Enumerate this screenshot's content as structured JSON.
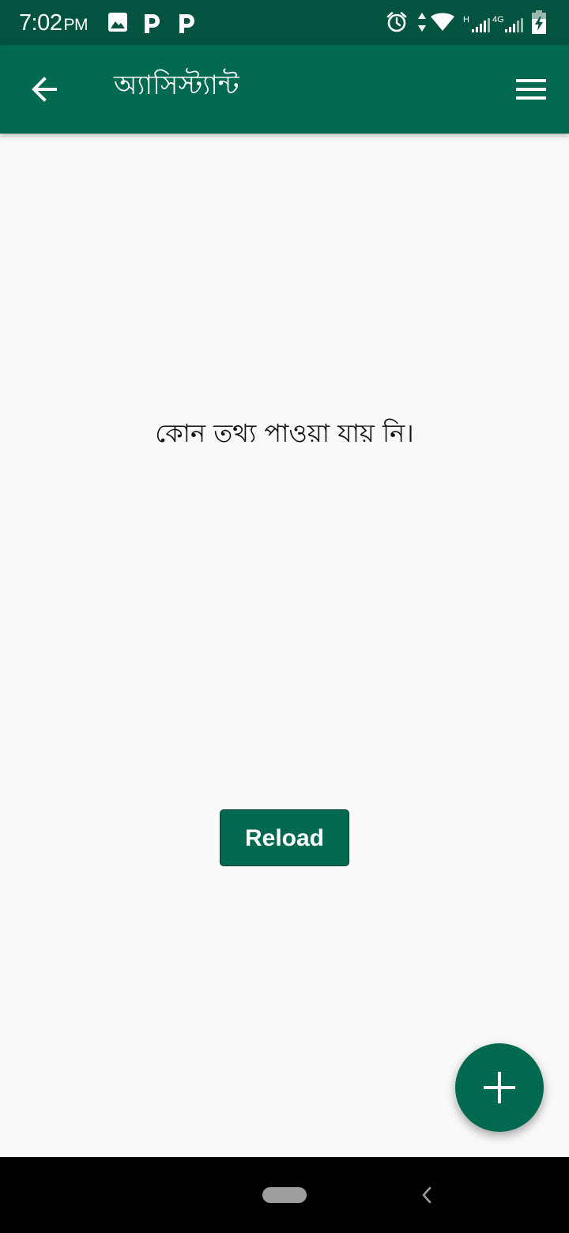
{
  "status_bar": {
    "time": "7:02",
    "ampm": "PM",
    "network_labels": [
      "H",
      "4G"
    ],
    "icons": [
      "image-notification-icon",
      "parking-app-icon",
      "parking-app-icon",
      "alarm-icon",
      "data-arrows-icon",
      "wifi-icon",
      "cell-signal-icon",
      "cell-signal-icon",
      "battery-charging-icon"
    ]
  },
  "app_bar": {
    "title": "অ্যাসিস্ট্যান্ট",
    "back_icon": "arrow-left-icon",
    "menu_icon": "hamburger-menu-icon"
  },
  "empty_state": {
    "message": "কোন তথ্য পাওয়া যায় নি।"
  },
  "reload_button": {
    "label": "Reload"
  },
  "fab": {
    "icon": "plus-icon"
  },
  "colors": {
    "status_bar": "#025440",
    "primary": "#016950",
    "background": "#f9f9f9",
    "navigation_bar": "#000000"
  }
}
